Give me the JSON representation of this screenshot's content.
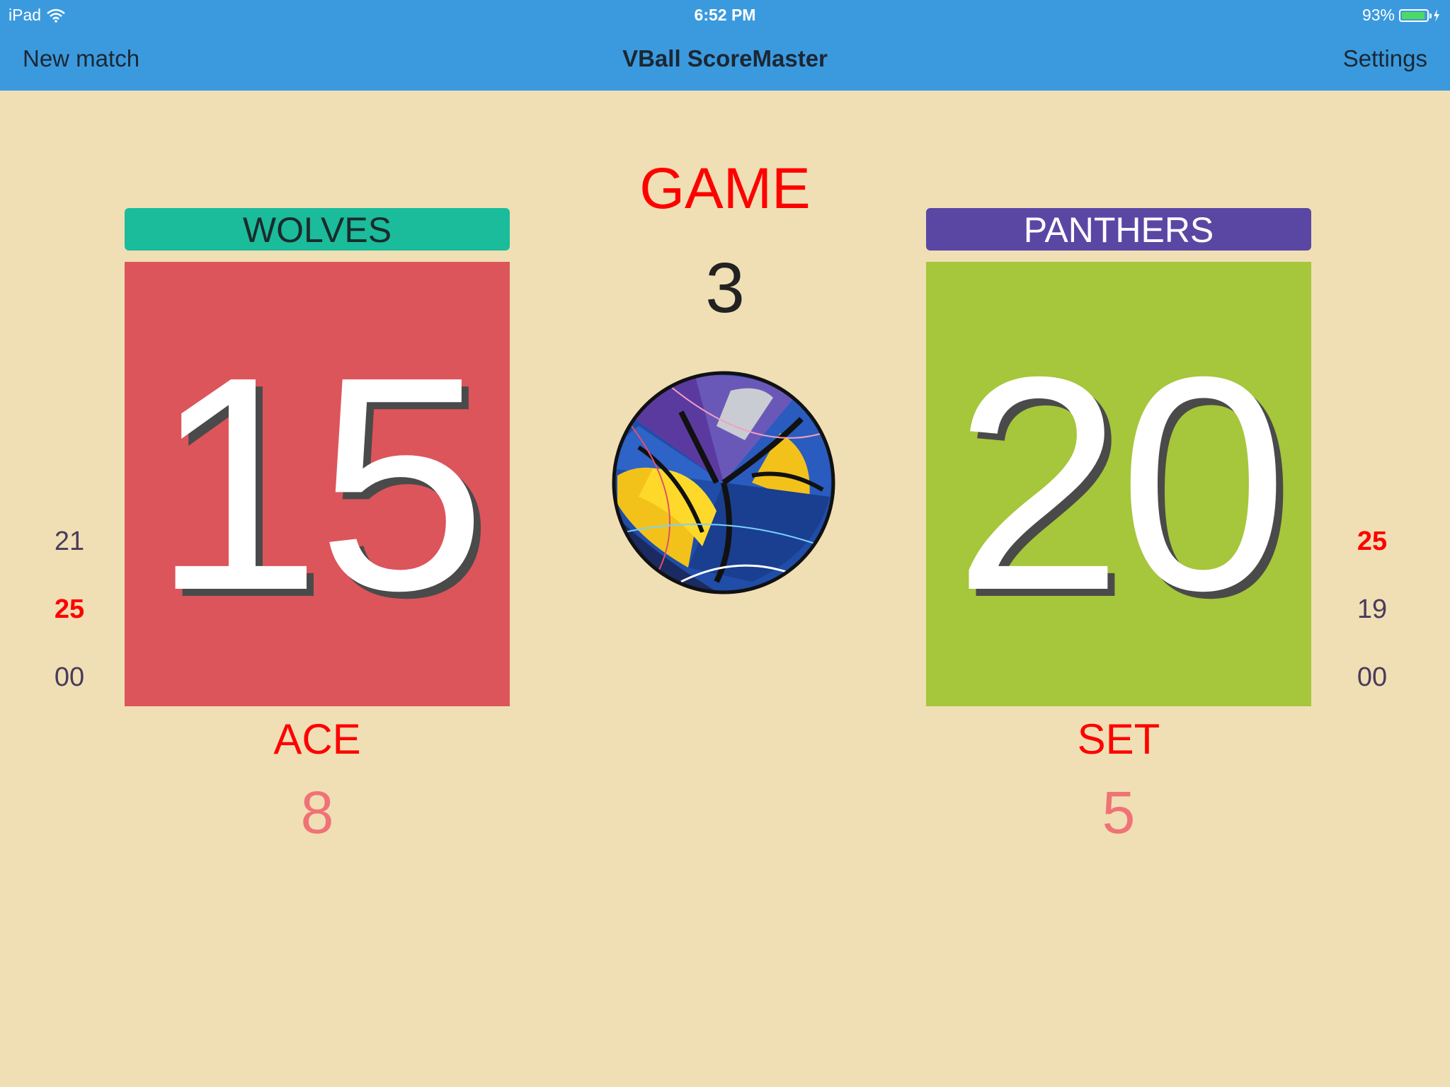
{
  "status_bar": {
    "device": "iPad",
    "time": "6:52 PM",
    "battery_text": "93%",
    "battery_level": 0.93
  },
  "nav": {
    "left": "New match",
    "title": "VBall ScoreMaster",
    "right": "Settings"
  },
  "game": {
    "label": "GAME",
    "number": "3"
  },
  "home": {
    "name": "WOLVES",
    "score": "15",
    "set_history": [
      "21",
      "25",
      "00"
    ],
    "stat_label": "ACE",
    "stat_value": "8",
    "banner_color": "#1abc9c",
    "score_color": "#dc555b"
  },
  "away": {
    "name": "PANTHERS",
    "score": "20",
    "set_history": [
      "25",
      "19",
      "00"
    ],
    "stat_label": "SET",
    "stat_value": "5",
    "banner_color": "#5a47a4",
    "score_color": "#a6c63b"
  },
  "colors": {
    "accent_blue": "#3b9ade",
    "background": "#f0dfb4",
    "highlight_red": "#ff0000",
    "stat_pink": "#f07277"
  },
  "icons": {
    "ball": "volleyball-icon",
    "wifi": "wifi-icon",
    "battery": "battery-icon"
  }
}
